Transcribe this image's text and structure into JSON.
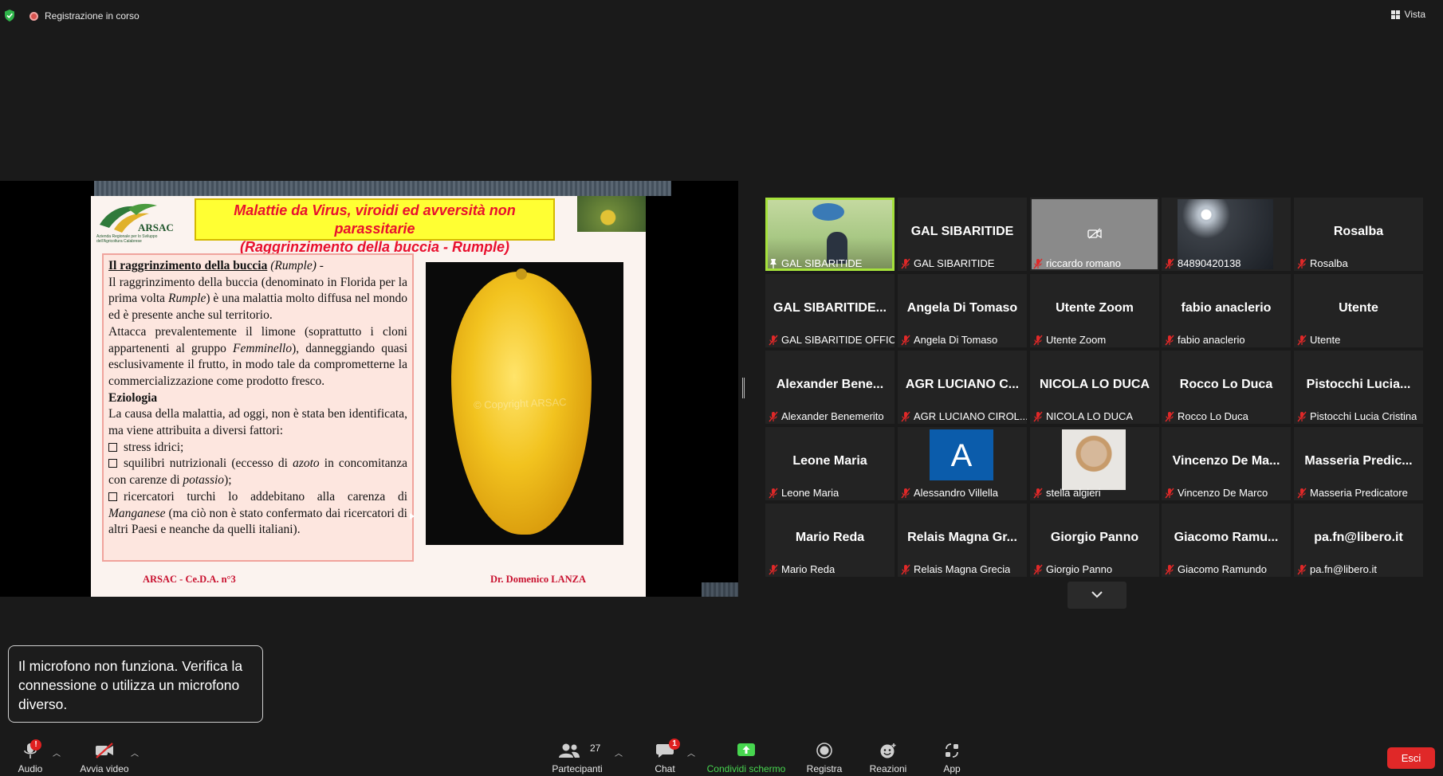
{
  "topbar": {
    "recording_label": "Registrazione in corso",
    "view_label": "Vista"
  },
  "slide": {
    "logo_text": "ARSAC",
    "logo_subtitle": "Azienda Regionale per lo Sviluppo dell'Agricoltura Calabrese",
    "title_line1": "Malattie da Virus, viroidi ed avversità non parassitarie",
    "title_line2": "(Raggrinzimento della buccia - Rumple)",
    "heading": "Il raggrinzimento della buccia",
    "heading_rumple": "(Rumple)",
    "heading_dash": " -",
    "para1_a": "Il raggrinzimento della buccia (denominato in Florida per la prima volta ",
    "para1_em": "Rumple",
    "para1_b": ") è una malattia molto diffusa nel mondo ed è presente anche sul territorio.",
    "para2_a": "Attacca prevalentemente il limone (soprattutto i cloni appartenenti al gruppo ",
    "para2_em": "Femminello",
    "para2_b": "), danneggiando quasi esclusivamente il frutto, in modo tale da comprometterne la commercializzazione come prodotto fresco.",
    "eziologia": "Eziologia",
    "para3": "La causa della malattia, ad oggi, non è stata ben identificata, ma viene attribuita a diversi fattori:",
    "bullet1": "stress idrici;",
    "bullet2_a": "squilibri nutrizionali (eccesso di ",
    "bullet2_em1": "azoto",
    "bullet2_b": " in concomitanza con carenze di ",
    "bullet2_em2": "potassio",
    "bullet2_c": ");",
    "bullet3_a": "ricercatori turchi lo addebitano alla carenza di ",
    "bullet3_em": "Manganese",
    "bullet3_b": " (ma ciò non è stato confermato dai ricercatori di altri Paesi e neanche da quelli italiani).",
    "watermark": "© Copyright ARSAC",
    "footer_left": "ARSAC - Ce.D.A. n°3",
    "footer_right": "Dr. Domenico LANZA"
  },
  "participants": [
    {
      "title": "",
      "name": "GAL SIBARITIDE",
      "video": "gal",
      "active": true
    },
    {
      "title": "GAL SIBARITIDE",
      "name": "GAL SIBARITIDE"
    },
    {
      "title": "",
      "name": "riccardo romano",
      "video": "camera-off"
    },
    {
      "title": "",
      "name": "84890420138",
      "video": "night"
    },
    {
      "title": "Rosalba",
      "name": "Rosalba"
    },
    {
      "title": "GAL SIBARITIDE...",
      "name": "GAL SIBARITIDE OFFICE"
    },
    {
      "title": "Angela Di Tomaso",
      "name": "Angela Di Tomaso"
    },
    {
      "title": "Utente Zoom",
      "name": "Utente Zoom"
    },
    {
      "title": "fabio anaclerio",
      "name": "fabio anaclerio"
    },
    {
      "title": "Utente",
      "name": "Utente"
    },
    {
      "title": "Alexander  Bene...",
      "name": "Alexander Benemerito"
    },
    {
      "title": "AGR LUCIANO C...",
      "name": "AGR LUCIANO CIROL..."
    },
    {
      "title": "NICOLA LO DUCA",
      "name": "NICOLA LO DUCA"
    },
    {
      "title": "Rocco Lo Duca",
      "name": "Rocco Lo Duca"
    },
    {
      "title": "Pistocchi  Lucia...",
      "name": "Pistocchi Lucia Cristina"
    },
    {
      "title": "Leone Maria",
      "name": "Leone Maria"
    },
    {
      "title": "",
      "name": "Alessandro Villella",
      "video": "avatar-letter",
      "letter": "A"
    },
    {
      "title": "",
      "name": "stella algieri",
      "video": "photo"
    },
    {
      "title": "Vincenzo  De  Ma...",
      "name": "Vincenzo De Marco"
    },
    {
      "title": "Masseria  Predic...",
      "name": "Masseria Predicatore"
    },
    {
      "title": "Mario Reda",
      "name": "Mario Reda"
    },
    {
      "title": "Relais  Magna  Gr...",
      "name": "Relais Magna Grecia"
    },
    {
      "title": "Giorgio Panno",
      "name": "Giorgio Panno"
    },
    {
      "title": "Giacomo  Ramu...",
      "name": "Giacomo Ramundo"
    },
    {
      "title": "pa.fn@libero.it",
      "name": "pa.fn@libero.it"
    }
  ],
  "toast": {
    "message": "Il microfono non funziona. Verifica la connessione o utilizza un microfono diverso."
  },
  "toolbar": {
    "audio_label": "Audio",
    "audio_badge": "!",
    "video_label": "Avvia video",
    "participants_label": "Partecipanti",
    "participants_count": "27",
    "chat_label": "Chat",
    "chat_badge": "1",
    "share_label": "Condividi schermo",
    "record_label": "Registra",
    "reactions_label": "Reazioni",
    "apps_label": "App",
    "exit_label": "Esci"
  },
  "colors": {
    "active_speaker": "#a5e13b",
    "share_green": "#47d64f",
    "exit_red": "#e02828",
    "mic_muted_red": "#e02828",
    "avatar_blue": "#0b5cab"
  }
}
